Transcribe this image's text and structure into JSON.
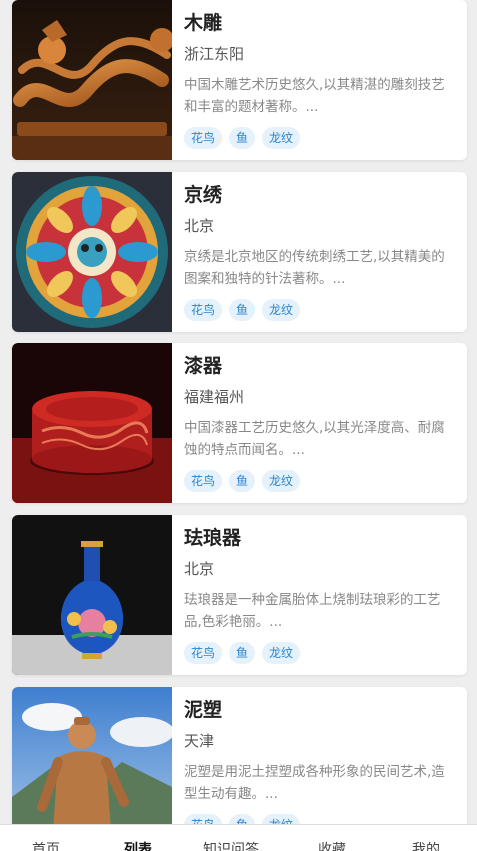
{
  "crafts": [
    {
      "title": "木雕",
      "region": "浙江东阳",
      "desc": "中国木雕艺术历史悠久,以其精湛的雕刻技艺和丰富的题材著称。...",
      "tags": [
        "花鸟",
        "鱼",
        "龙纹"
      ],
      "image": "wood-dragon-carving"
    },
    {
      "title": "京绣",
      "region": "北京",
      "desc": "京绣是北京地区的传统刺绣工艺,以其精美的图案和独特的针法著称。...",
      "tags": [
        "花鸟",
        "鱼",
        "龙纹"
      ],
      "image": "embroidery-mandala"
    },
    {
      "title": "漆器",
      "region": "福建福州",
      "desc": "中国漆器工艺历史悠久,以其光泽度高、耐腐蚀的特点而闻名。...",
      "tags": [
        "花鸟",
        "鱼",
        "龙纹"
      ],
      "image": "red-lacquer-box"
    },
    {
      "title": "珐琅器",
      "region": "北京",
      "desc": "珐琅器是一种金属胎体上烧制珐琅彩的工艺品,色彩艳丽。...",
      "tags": [
        "花鸟",
        "鱼",
        "龙纹"
      ],
      "image": "cloisonne-vase"
    },
    {
      "title": "泥塑",
      "region": "天津",
      "desc": "泥塑是用泥土捏塑成各种形象的民间艺术,造型生动有趣。...",
      "tags": [
        "花鸟",
        "鱼",
        "龙纹"
      ],
      "image": "clay-figure-statue"
    }
  ],
  "tabbar": {
    "items": [
      "首页",
      "列表",
      "知识问答",
      "收藏",
      "我的"
    ],
    "active": "列表"
  }
}
